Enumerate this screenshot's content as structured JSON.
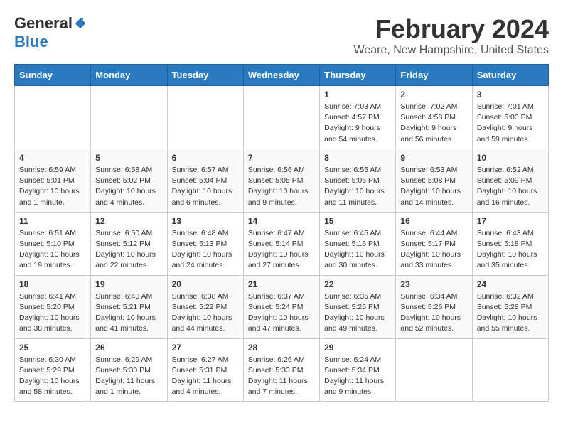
{
  "header": {
    "logo_line1": "General",
    "logo_line2": "Blue",
    "month_title": "February 2024",
    "location": "Weare, New Hampshire, United States"
  },
  "days_of_week": [
    "Sunday",
    "Monday",
    "Tuesday",
    "Wednesday",
    "Thursday",
    "Friday",
    "Saturday"
  ],
  "weeks": [
    [
      {
        "day": "",
        "info": ""
      },
      {
        "day": "",
        "info": ""
      },
      {
        "day": "",
        "info": ""
      },
      {
        "day": "",
        "info": ""
      },
      {
        "day": "1",
        "info": "Sunrise: 7:03 AM\nSunset: 4:57 PM\nDaylight: 9 hours\nand 54 minutes."
      },
      {
        "day": "2",
        "info": "Sunrise: 7:02 AM\nSunset: 4:58 PM\nDaylight: 9 hours\nand 56 minutes."
      },
      {
        "day": "3",
        "info": "Sunrise: 7:01 AM\nSunset: 5:00 PM\nDaylight: 9 hours\nand 59 minutes."
      }
    ],
    [
      {
        "day": "4",
        "info": "Sunrise: 6:59 AM\nSunset: 5:01 PM\nDaylight: 10 hours\nand 1 minute."
      },
      {
        "day": "5",
        "info": "Sunrise: 6:58 AM\nSunset: 5:02 PM\nDaylight: 10 hours\nand 4 minutes."
      },
      {
        "day": "6",
        "info": "Sunrise: 6:57 AM\nSunset: 5:04 PM\nDaylight: 10 hours\nand 6 minutes."
      },
      {
        "day": "7",
        "info": "Sunrise: 6:56 AM\nSunset: 5:05 PM\nDaylight: 10 hours\nand 9 minutes."
      },
      {
        "day": "8",
        "info": "Sunrise: 6:55 AM\nSunset: 5:06 PM\nDaylight: 10 hours\nand 11 minutes."
      },
      {
        "day": "9",
        "info": "Sunrise: 6:53 AM\nSunset: 5:08 PM\nDaylight: 10 hours\nand 14 minutes."
      },
      {
        "day": "10",
        "info": "Sunrise: 6:52 AM\nSunset: 5:09 PM\nDaylight: 10 hours\nand 16 minutes."
      }
    ],
    [
      {
        "day": "11",
        "info": "Sunrise: 6:51 AM\nSunset: 5:10 PM\nDaylight: 10 hours\nand 19 minutes."
      },
      {
        "day": "12",
        "info": "Sunrise: 6:50 AM\nSunset: 5:12 PM\nDaylight: 10 hours\nand 22 minutes."
      },
      {
        "day": "13",
        "info": "Sunrise: 6:48 AM\nSunset: 5:13 PM\nDaylight: 10 hours\nand 24 minutes."
      },
      {
        "day": "14",
        "info": "Sunrise: 6:47 AM\nSunset: 5:14 PM\nDaylight: 10 hours\nand 27 minutes."
      },
      {
        "day": "15",
        "info": "Sunrise: 6:45 AM\nSunset: 5:16 PM\nDaylight: 10 hours\nand 30 minutes."
      },
      {
        "day": "16",
        "info": "Sunrise: 6:44 AM\nSunset: 5:17 PM\nDaylight: 10 hours\nand 33 minutes."
      },
      {
        "day": "17",
        "info": "Sunrise: 6:43 AM\nSunset: 5:18 PM\nDaylight: 10 hours\nand 35 minutes."
      }
    ],
    [
      {
        "day": "18",
        "info": "Sunrise: 6:41 AM\nSunset: 5:20 PM\nDaylight: 10 hours\nand 38 minutes."
      },
      {
        "day": "19",
        "info": "Sunrise: 6:40 AM\nSunset: 5:21 PM\nDaylight: 10 hours\nand 41 minutes."
      },
      {
        "day": "20",
        "info": "Sunrise: 6:38 AM\nSunset: 5:22 PM\nDaylight: 10 hours\nand 44 minutes."
      },
      {
        "day": "21",
        "info": "Sunrise: 6:37 AM\nSunset: 5:24 PM\nDaylight: 10 hours\nand 47 minutes."
      },
      {
        "day": "22",
        "info": "Sunrise: 6:35 AM\nSunset: 5:25 PM\nDaylight: 10 hours\nand 49 minutes."
      },
      {
        "day": "23",
        "info": "Sunrise: 6:34 AM\nSunset: 5:26 PM\nDaylight: 10 hours\nand 52 minutes."
      },
      {
        "day": "24",
        "info": "Sunrise: 6:32 AM\nSunset: 5:28 PM\nDaylight: 10 hours\nand 55 minutes."
      }
    ],
    [
      {
        "day": "25",
        "info": "Sunrise: 6:30 AM\nSunset: 5:29 PM\nDaylight: 10 hours\nand 58 minutes."
      },
      {
        "day": "26",
        "info": "Sunrise: 6:29 AM\nSunset: 5:30 PM\nDaylight: 11 hours\nand 1 minute."
      },
      {
        "day": "27",
        "info": "Sunrise: 6:27 AM\nSunset: 5:31 PM\nDaylight: 11 hours\nand 4 minutes."
      },
      {
        "day": "28",
        "info": "Sunrise: 6:26 AM\nSunset: 5:33 PM\nDaylight: 11 hours\nand 7 minutes."
      },
      {
        "day": "29",
        "info": "Sunrise: 6:24 AM\nSunset: 5:34 PM\nDaylight: 11 hours\nand 9 minutes."
      },
      {
        "day": "",
        "info": ""
      },
      {
        "day": "",
        "info": ""
      }
    ]
  ]
}
